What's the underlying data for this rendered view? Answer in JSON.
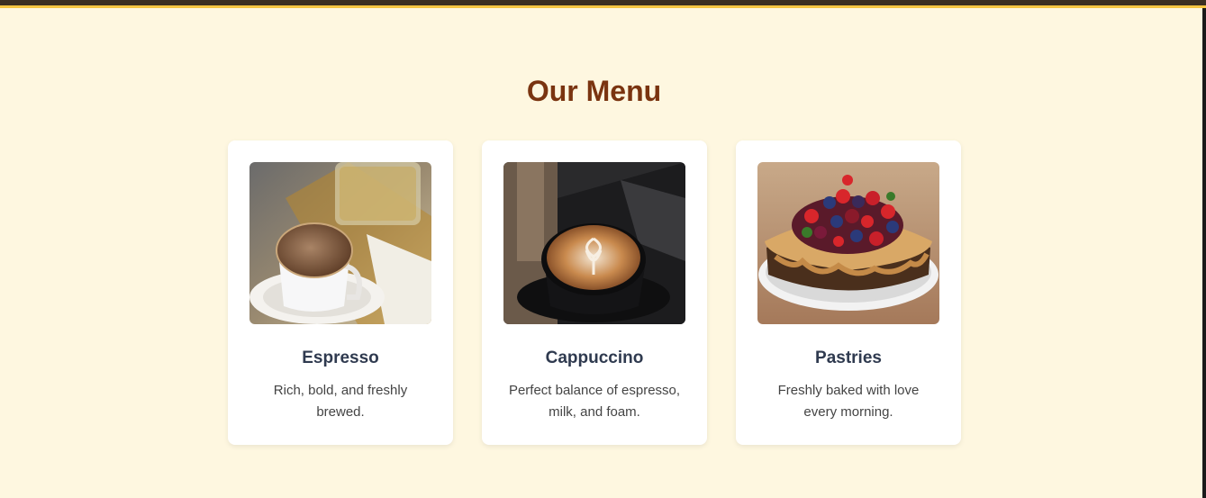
{
  "page": {
    "title": "Our Menu"
  },
  "menu": {
    "items": [
      {
        "name": "Espresso",
        "description": "Rich, bold, and freshly brewed.",
        "image": "espresso-photo"
      },
      {
        "name": "Cappuccino",
        "description": "Perfect balance of espresso, milk, and foam.",
        "image": "cappuccino-photo"
      },
      {
        "name": "Pastries",
        "description": "Freshly baked with love every morning.",
        "image": "pastries-photo"
      }
    ]
  },
  "colors": {
    "background": "#fef7e0",
    "accent": "#f5c542",
    "title": "#7a3410",
    "card_title": "#2f3a4f"
  }
}
